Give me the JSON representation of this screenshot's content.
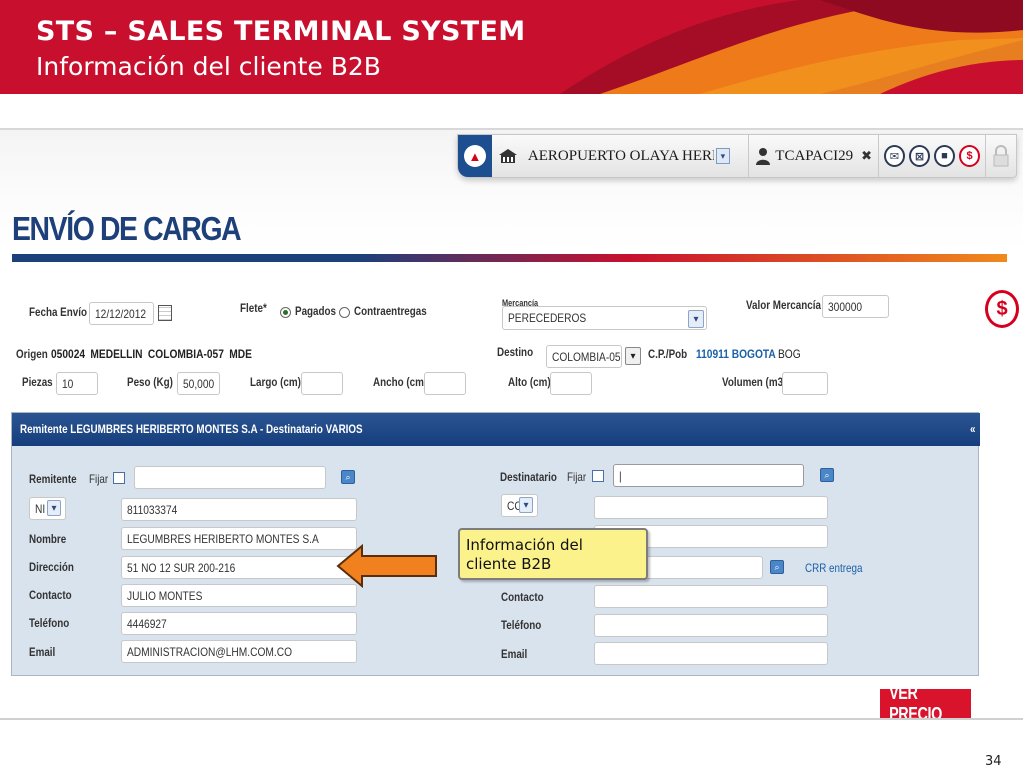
{
  "slide": {
    "title": "STS – SALES  TERMINAL SYSTEM",
    "subtitle": "Información del cliente B2B",
    "page_number": "34"
  },
  "toolbar": {
    "location": "AEROPUERTO OLAYA HERRE",
    "user": "TCAPACI29",
    "close_glyph": "✖",
    "dollar_glyph": "$"
  },
  "page": {
    "title": "ENVÍO DE CARGA"
  },
  "form": {
    "fecha_envio_label": "Fecha Envío",
    "fecha_envio_value": "12/12/2012",
    "flete_label": "Flete*",
    "pagados_label": "Pagados",
    "contraentregas_label": "Contraentregas",
    "mercancia_label": "Mercancía",
    "mercancia_value": "PERECEDEROS",
    "valor_mercancia_label": "Valor Mercancía",
    "valor_mercancia_value": "300000",
    "origen_label": "Origen",
    "origen_value": "050024   MEDELLIN   COLOMBIA-057   MDE",
    "destino_label": "Destino",
    "destino_value": "COLOMBIA-05",
    "cp_pob_label": "C.P./Pob",
    "cp_pob_value": "110911 BOGOTA",
    "cp_pob_code": "BOG",
    "piezas_label": "Piezas",
    "piezas_value": "10",
    "peso_label": "Peso (Kg)",
    "peso_value": "50,000",
    "largo_label": "Largo (cm)",
    "ancho_label": "Ancho (cm)",
    "alto_label": "Alto (cm)",
    "volumen_label": "Volumen (m3)"
  },
  "panel": {
    "header": "Remitente LEGUMBRES HERIBERTO MONTES S.A - Destinatario VARIOS",
    "collapse_glyph": "«",
    "remitente": {
      "title": "Remitente",
      "fijar_label": "Fijar",
      "doc_type": "NI",
      "doc_number": "811033374",
      "nombre_label": "Nombre",
      "nombre_value": "LEGUMBRES HERIBERTO MONTES S.A",
      "direccion_label": "Dirección",
      "direccion_value": "51 NO 12 SUR 200-216",
      "contacto_label": "Contacto",
      "contacto_value": "JULIO MONTES",
      "telefono_label": "Teléfono",
      "telefono_value": "4446927",
      "email_label": "Email",
      "email_value": "ADMINISTRACION@LHM.COM.CO"
    },
    "destinatario": {
      "title": "Destinatario",
      "fijar_label": "Fijar",
      "doc_type": "CC",
      "crr_link": "CRR entrega",
      "contacto_label": "Contacto",
      "telefono_label": "Teléfono",
      "email_label": "Email"
    }
  },
  "callout": {
    "text_line1": "Información del",
    "text_line2": "cliente B2B"
  },
  "buttons": {
    "ver_precio": "VER PRECIO"
  },
  "colors": {
    "banner_red": "#c8102e",
    "navy": "#1d3f7a",
    "callout_yellow": "#fbf28c",
    "arrow_orange": "#f0811e",
    "button_red": "#d8132b"
  }
}
